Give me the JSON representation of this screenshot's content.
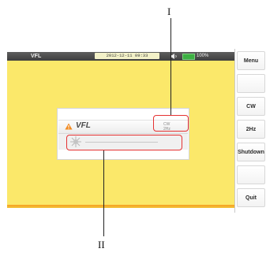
{
  "status_bar": {
    "app_name": "VFL",
    "datetime": "2012-12-11 09:33",
    "battery": "100%"
  },
  "sidebar": {
    "items": [
      {
        "label": "Menu"
      },
      {
        "label": ""
      },
      {
        "label": "CW"
      },
      {
        "label": "2Hz"
      },
      {
        "label": "Shutdown"
      },
      {
        "label": ""
      },
      {
        "label": "Quit"
      }
    ]
  },
  "dialog": {
    "title": "VFL",
    "mode_line1": "CW",
    "mode_line2": "2Hz"
  },
  "annotations": {
    "label_top": "I",
    "label_bottom": "II"
  },
  "colors": {
    "screen_bg": "#fbe86a",
    "callout": "#e53232",
    "warning": "#f28b22"
  }
}
